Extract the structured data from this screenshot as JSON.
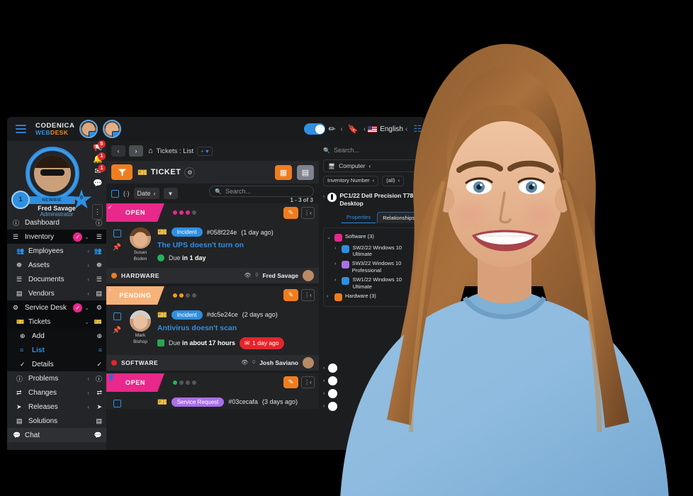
{
  "app": {
    "brand_line1": "CODENICA",
    "brand_line2_a": "WEB",
    "brand_line2_b": "DESK",
    "language": "English"
  },
  "profile": {
    "name": "Fred Savage",
    "role": "Administrator",
    "level": "1",
    "points": "0",
    "rank": "NEWBIE"
  },
  "notifications": [
    {
      "icon": "megaphone-icon",
      "glyph": "📢",
      "count": "5"
    },
    {
      "icon": "bell-icon",
      "glyph": "🔔",
      "count": "1"
    },
    {
      "icon": "mail-icon",
      "glyph": "✉",
      "count": "1"
    },
    {
      "icon": "chat-icon",
      "glyph": "💬",
      "count": ""
    }
  ],
  "sidebar": {
    "items": [
      {
        "label": "Dashboard",
        "glyph": "ⓘ",
        "right_glyph": "ⓘ",
        "chev": "",
        "badge": "",
        "level": 0,
        "active": false,
        "blue": false
      },
      {
        "label": "Inventory",
        "glyph": "☰",
        "right_glyph": "☰",
        "chev": "⌄",
        "badge": "✓",
        "level": 0,
        "active": true,
        "blue": false
      },
      {
        "label": "Employees",
        "glyph": "👥",
        "right_glyph": "👥",
        "chev": "‹",
        "badge": "",
        "level": 1,
        "active": false,
        "blue": false
      },
      {
        "label": "Assets",
        "glyph": "☸",
        "right_glyph": "☸",
        "chev": "‹",
        "badge": "",
        "level": 1,
        "active": false,
        "blue": false
      },
      {
        "label": "Documents",
        "glyph": "☰",
        "right_glyph": "☰",
        "chev": "‹",
        "badge": "",
        "level": 1,
        "active": false,
        "blue": false
      },
      {
        "label": "Vendors",
        "glyph": "▤",
        "right_glyph": "▤",
        "chev": "‹",
        "badge": "",
        "level": 1,
        "active": false,
        "blue": false
      },
      {
        "label": "Service Desk",
        "glyph": "⚙",
        "right_glyph": "⚙",
        "chev": "⌄",
        "badge": "✓",
        "level": 0,
        "active": true,
        "blue": false
      },
      {
        "label": "Tickets",
        "glyph": "🎫",
        "right_glyph": "🎫",
        "chev": "⌄",
        "badge": "",
        "level": 1,
        "active": true,
        "blue": false
      },
      {
        "label": "Add",
        "glyph": "⊕",
        "right_glyph": "⊕",
        "chev": "",
        "badge": "",
        "level": 2,
        "active": false,
        "blue": false
      },
      {
        "label": "List",
        "glyph": "≡",
        "right_glyph": "≡",
        "chev": "",
        "badge": "",
        "level": 2,
        "active": false,
        "blue": true
      },
      {
        "label": "Details",
        "glyph": "✓",
        "right_glyph": "✓",
        "chev": "",
        "badge": "",
        "level": 2,
        "active": false,
        "blue": false
      },
      {
        "label": "Problems",
        "glyph": "ⓘ",
        "right_glyph": "ⓘ",
        "chev": "‹",
        "badge": "",
        "level": 1,
        "active": false,
        "blue": false
      },
      {
        "label": "Changes",
        "glyph": "⇄",
        "right_glyph": "⇄",
        "chev": "‹",
        "badge": "",
        "level": 1,
        "active": false,
        "blue": false
      },
      {
        "label": "Releases",
        "glyph": "➤",
        "right_glyph": "➤",
        "chev": "‹",
        "badge": "",
        "level": 1,
        "active": false,
        "blue": false
      },
      {
        "label": "Solutions",
        "glyph": "▤",
        "right_glyph": "▤",
        "chev": "",
        "badge": "",
        "level": 1,
        "active": false,
        "blue": false
      },
      {
        "label": "Chat",
        "glyph": "💬",
        "right_glyph": "💬",
        "chev": "",
        "badge": "",
        "level": 0,
        "active": false,
        "blue": false
      }
    ]
  },
  "breadcrumb": {
    "back_glyph": "‹",
    "fwd_glyph": "›",
    "home_glyph": "⌂",
    "path": "Tickets : List",
    "pin_glyph": "+ ♥"
  },
  "toolbar": {
    "ticket_label": "TICKET",
    "ticket_icon_glyph": "🎫",
    "badge_glyph": "⚙",
    "filter_icon": "funnel-icon",
    "grid_glyph": "▦",
    "table_glyph": "▤"
  },
  "listbar": {
    "star_label": "(∙)",
    "sort_label": "Date",
    "sort_chev": "‹",
    "dropdown_glyph": "▼",
    "search_placeholder": "Search...",
    "count": "1 - 3 of 3"
  },
  "tickets": [
    {
      "status": "OPEN",
      "status_color": "#e8288b",
      "corner_glyph": "✓",
      "dots": [
        "#e8288b",
        "#e8288b",
        "#e8288b",
        "#55575b"
      ],
      "type": "Incident",
      "type_color": "#2f8fe0",
      "id": "#058f224e",
      "age": "(1 day ago)",
      "title": "The UPS doesn't turn on",
      "due_label": "Due",
      "due_value": "in 1 day",
      "due_color": "#22b35e",
      "late_badge": "",
      "requester_name": "Susan",
      "requester_surname": "Boden",
      "category": "HARDWARE",
      "category_color": "#ef7d1e",
      "views": "0",
      "assignee": "Fred Savage"
    },
    {
      "status": "PENDING",
      "status_color": "#f7b27a",
      "corner_glyph": "◔",
      "dots": [
        "#ef9b1e",
        "#ef9b1e",
        "#55575b",
        "#55575b"
      ],
      "type": "Incident",
      "type_color": "#2f8fe0",
      "id": "#dc5e24ce",
      "age": "(2 days ago)",
      "title": "Antivirus doesn't scan",
      "due_label": "Due",
      "due_value": "in about 17 hours",
      "due_color": "#2aa34f",
      "late_badge": "1 day ago",
      "requester_name": "Mark",
      "requester_surname": "Bishop",
      "category": "SOFTWARE",
      "category_color": "#e4252b",
      "views": "0",
      "assignee": "Josh Saviano"
    },
    {
      "status": "OPEN",
      "status_color": "#e8288b",
      "corner_glyph": "👤",
      "dots": [
        "#22b35e",
        "#55575b",
        "#55575b",
        "#55575b"
      ],
      "type": "Service Request",
      "type_color": "#a970e8",
      "id": "#03cecafa",
      "age": "(3 days ago)",
      "title": "",
      "due_label": "",
      "due_value": "",
      "due_color": "#22b35e",
      "late_badge": "",
      "requester_name": "",
      "requester_surname": "",
      "category": "",
      "category_color": "#ef7d1e",
      "views": "",
      "assignee": ""
    }
  ],
  "right_panel": {
    "search_placeholder": "Search...",
    "filter_label": "Computer",
    "filter_chev": "‹",
    "chip1": "Inventory Number",
    "chip2": "(all)",
    "node_title": "PC1/22 Dell Precision T7820 Desktop",
    "tabs": [
      {
        "label": "Properties",
        "active": false
      },
      {
        "label": "Relationships",
        "active": true
      }
    ],
    "tree": [
      {
        "label": "Software (3)",
        "color": "#e8288b",
        "chev": "⌄",
        "indent": 0
      },
      {
        "label": "SW2/22 Windows 10 Ultimate",
        "color": "#2f8fe0",
        "chev": "›",
        "indent": 1
      },
      {
        "label": "SW3/22 Windows 10 Professional",
        "color": "#a970e8",
        "chev": "›",
        "indent": 1
      },
      {
        "label": "SW1/22 Windows 10 Ultimate",
        "color": "#2f8fe0",
        "chev": "›",
        "indent": 1
      },
      {
        "label": "Hardware (3)",
        "color": "#ef7d1e",
        "chev": "›",
        "indent": 0
      }
    ],
    "bottom_rows": [
      {
        "chev": "›"
      },
      {
        "chev": "›"
      },
      {
        "chev": "›"
      },
      {
        "chev": "›"
      }
    ]
  },
  "colors": {
    "accent_orange": "#ef7d1e",
    "accent_blue": "#2f8fe0",
    "accent_pink": "#e8288b",
    "danger_red": "#e4252b",
    "success_green": "#22b35e"
  }
}
